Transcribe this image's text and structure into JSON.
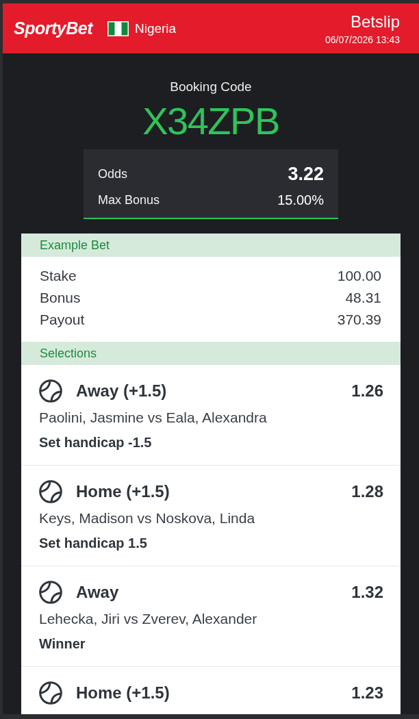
{
  "header": {
    "logo": "SportyBet",
    "country": "Nigeria",
    "title": "Betslip",
    "datetime": "06/07/2026 13:43"
  },
  "booking": {
    "label": "Booking Code",
    "code": "X34ZPB"
  },
  "summary": [
    {
      "kind": "emphasis",
      "label": "Odds",
      "value": "3.22"
    },
    {
      "kind": "plain",
      "label": "Max Bonus",
      "value": "15.00%"
    }
  ],
  "example_bet": {
    "title": "Example Bet",
    "rows": [
      {
        "label": "Stake",
        "value": "100.00"
      },
      {
        "label": "Bonus",
        "value": "48.31"
      },
      {
        "label": "Payout",
        "value": "370.39"
      }
    ]
  },
  "selections": {
    "title": "Selections",
    "items": [
      {
        "pick": "Away (+1.5)",
        "odds": "1.26",
        "match": "Paolini, Jasmine vs Eala, Alexandra",
        "market": "Set handicap -1.5"
      },
      {
        "pick": "Home (+1.5)",
        "odds": "1.28",
        "match": "Keys, Madison vs Noskova, Linda",
        "market": "Set handicap 1.5"
      },
      {
        "pick": "Away",
        "odds": "1.32",
        "match": "Lehecka, Jiri vs Zverev, Alexander",
        "market": "Winner"
      },
      {
        "pick": "Home (+1.5)",
        "odds": "1.23"
      }
    ]
  }
}
